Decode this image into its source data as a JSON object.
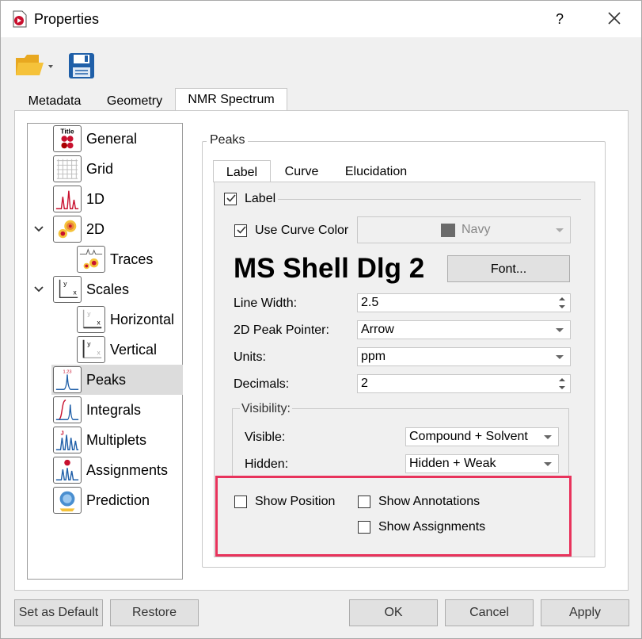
{
  "window": {
    "title": "Properties",
    "help_label": "?"
  },
  "toolbar": {
    "open_icon": "folder-icon",
    "save_icon": "floppy-disk-icon"
  },
  "top_tabs": [
    {
      "label": "Metadata"
    },
    {
      "label": "Geometry"
    },
    {
      "label": "NMR Spectrum"
    }
  ],
  "tree": {
    "items": [
      {
        "label": "General",
        "icon": "title-icon"
      },
      {
        "label": "Grid",
        "icon": "grid-icon"
      },
      {
        "label": "1D",
        "icon": "spectrum-1d-icon"
      },
      {
        "label": "2D",
        "icon": "spectrum-2d-icon"
      },
      {
        "label": "Traces",
        "icon": "traces-icon"
      },
      {
        "label": "Scales",
        "icon": "scales-icon"
      },
      {
        "label": "Horizontal",
        "icon": "horizontal-scale-icon"
      },
      {
        "label": "Vertical",
        "icon": "vertical-scale-icon"
      },
      {
        "label": "Peaks",
        "icon": "peaks-icon"
      },
      {
        "label": "Integrals",
        "icon": "integrals-icon"
      },
      {
        "label": "Multiplets",
        "icon": "multiplets-icon"
      },
      {
        "label": "Assignments",
        "icon": "assignments-icon"
      },
      {
        "label": "Prediction",
        "icon": "prediction-icon"
      }
    ]
  },
  "peaks": {
    "group_title": "Peaks",
    "subtabs": [
      {
        "label": "Label"
      },
      {
        "label": "Curve"
      },
      {
        "label": "Elucidation"
      }
    ],
    "label_check": "Label",
    "use_curve_color": "Use Curve Color",
    "color_value": "Navy",
    "color_swatch": "#6b6b6b",
    "font_preview": "MS Shell Dlg 2",
    "font_button": "Font...",
    "line_width_label": "Line Width:",
    "line_width_value": "2.5",
    "pointer_label": "2D Peak Pointer:",
    "pointer_value": "Arrow",
    "units_label": "Units:",
    "units_value": "ppm",
    "decimals_label": "Decimals:",
    "decimals_value": "2",
    "visibility_title": "Visibility:",
    "visible_label": "Visible:",
    "visible_value": "Compound + Solvent",
    "hidden_label": "Hidden:",
    "hidden_value": "Hidden + Weak",
    "show_position": "Show Position",
    "show_annotations": "Show Annotations",
    "show_assignments": "Show Assignments"
  },
  "buttons": {
    "set_default": "Set as Default",
    "restore": "Restore",
    "ok": "OK",
    "cancel": "Cancel",
    "apply": "Apply"
  },
  "colors": {
    "highlight": "#e8335c",
    "selected_row": "#dcdcdc"
  }
}
